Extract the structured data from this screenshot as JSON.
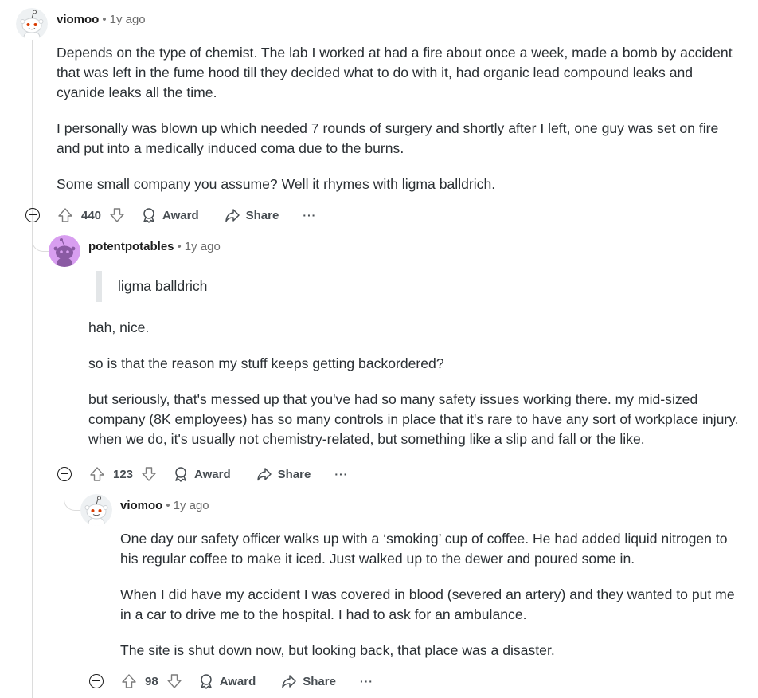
{
  "comments": [
    {
      "author": "viomoo",
      "separator": "•",
      "time": "1y ago",
      "paragraphs": [
        "Depends on the type of chemist. The lab I worked at had a fire about once a week, made a bomb by accident that was left in the fume hood till they decided what to do with it, had organic lead compound leaks and cyanide leaks all the time.",
        "I personally was blown up which needed 7 rounds of surgery and shortly after I left, one guy was set on fire and put into a medically induced coma due to the burns.",
        "Some small company you assume? Well it rhymes with ligma balldrich."
      ],
      "score": "440",
      "award_label": "Award",
      "share_label": "Share",
      "more_label": "···"
    },
    {
      "author": "potentpotables",
      "separator": "•",
      "time": "1y ago",
      "quote": "ligma balldrich",
      "paragraphs": [
        "hah, nice.",
        "so is that the reason my stuff keeps getting backordered?",
        "but seriously, that's messed up that you've had so many safety issues working there. my mid-sized company (8K employees) has so many controls in place that it's rare to have any sort of workplace injury. when we do, it's usually not chemistry-related, but something like a slip and fall or the like."
      ],
      "score": "123",
      "award_label": "Award",
      "share_label": "Share",
      "more_label": "···"
    },
    {
      "author": "viomoo",
      "separator": "•",
      "time": "1y ago",
      "paragraphs": [
        "One day our safety officer walks up with a ‘smoking’ cup of coffee. He had added liquid nitrogen to his regular coffee to make it iced. Just walked up to the dewer and poured some in.",
        "When I did have my accident I was covered in blood (severed an artery) and they wanted to put me in a car to drive me to the hospital. I had to ask for an ambulance.",
        "The site is shut down now, but looking back, that place was a disaster."
      ],
      "score": "98",
      "award_label": "Award",
      "share_label": "Share",
      "more_label": "···"
    }
  ],
  "colors": {
    "thread_line": "#dcdcdc",
    "snoo_red": "#d93a00",
    "purple_avatar": "#d89ef0"
  },
  "icons": [
    "collapse-icon",
    "upvote-icon",
    "downvote-icon",
    "award-icon",
    "share-icon",
    "more-icon",
    "avatar-snoo"
  ]
}
